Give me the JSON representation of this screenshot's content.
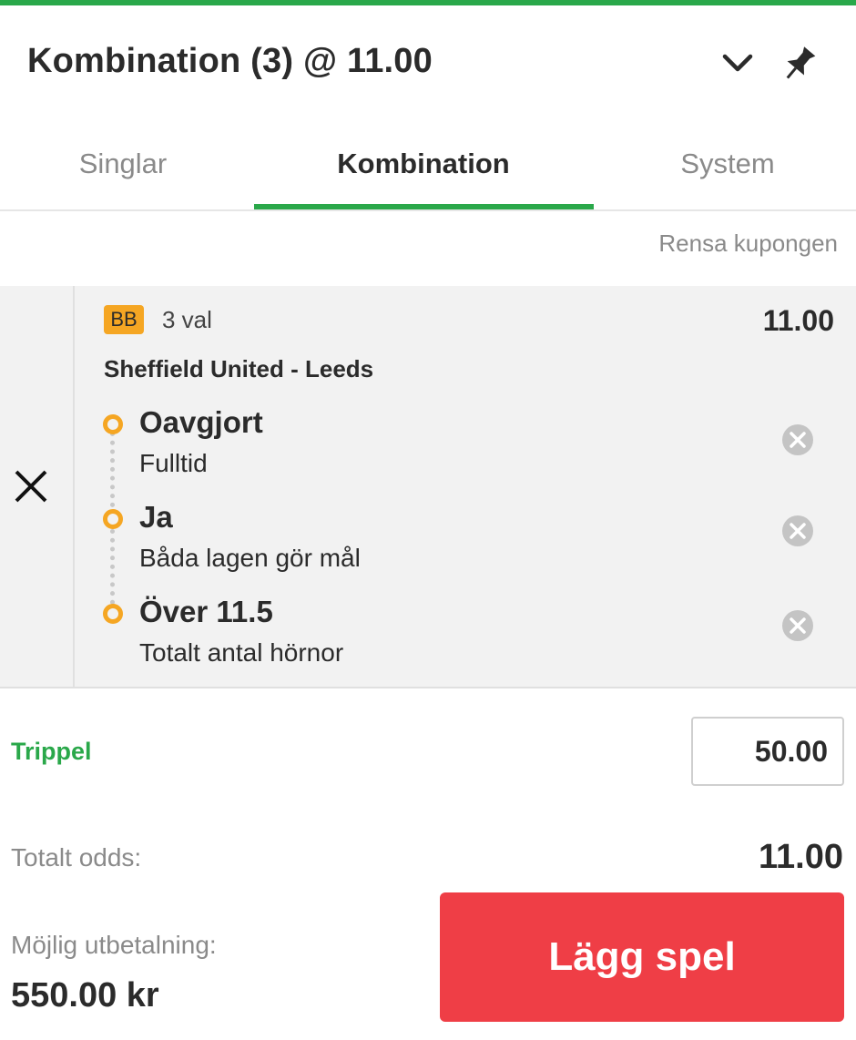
{
  "header": {
    "title": "Kombination (3) @ 11.00",
    "chevron_icon": "chevron-down-icon",
    "pin_icon": "pin-icon"
  },
  "tabs": [
    {
      "label": "Singlar",
      "active": false
    },
    {
      "label": "Kombination",
      "active": true
    },
    {
      "label": "System",
      "active": false
    }
  ],
  "clear_link": "Rensa kupongen",
  "bet": {
    "badge": "BB",
    "count": "3 val",
    "odds": "11.00",
    "match": "Sheffield United - Leeds",
    "selections": [
      {
        "name": "Oavgjort",
        "market": "Fulltid"
      },
      {
        "name": "Ja",
        "market": "Båda lagen gör mål"
      },
      {
        "name": "Över 11.5",
        "market": "Totalt antal hörnor"
      }
    ]
  },
  "stake": {
    "label": "Trippel",
    "value": "50.00"
  },
  "summary": {
    "odds_label": "Totalt odds:",
    "odds_value": "11.00",
    "payout_label": "Möjlig utbetalning:",
    "payout_value": "550.00 kr"
  },
  "place_bet_label": "Lägg spel",
  "colors": {
    "accent": "#2aa84a",
    "badge": "#f5a623",
    "button": "#ef3e46"
  }
}
